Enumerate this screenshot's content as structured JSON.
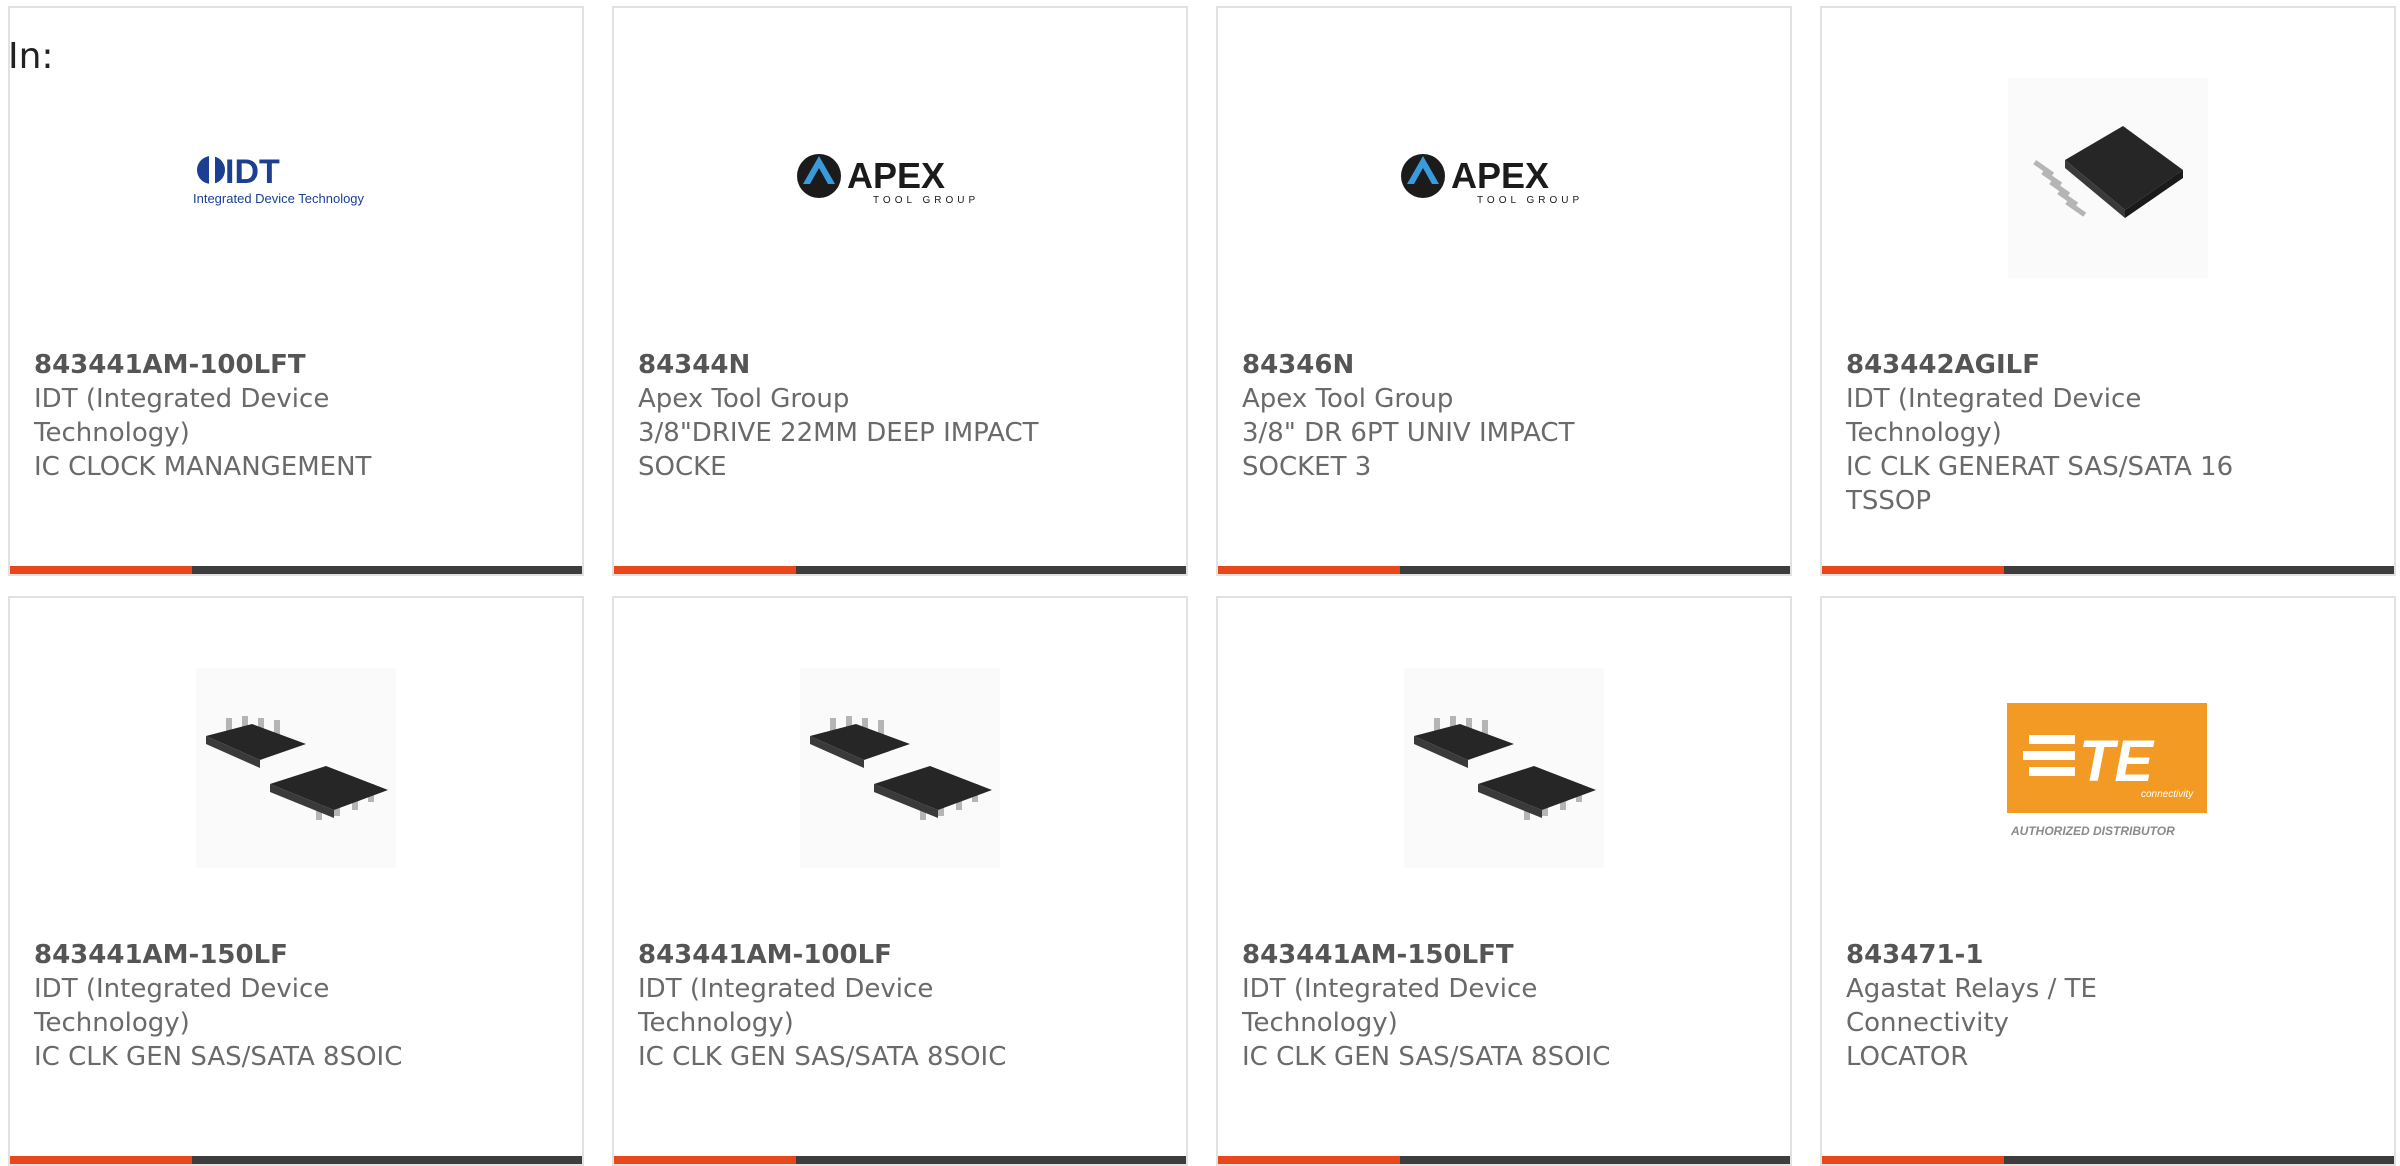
{
  "prefix_label": "In:",
  "colors": {
    "accent": "#e8461b",
    "bar": "#3d3d3d",
    "te_orange": "#f39a24",
    "idt_blue": "#1c3f94",
    "border": "#e1e1e1"
  },
  "cards": [
    {
      "part": "843441AM-100LFT",
      "manufacturer": "IDT (Integrated Device Technology)",
      "description": "IC CLOCK MANANGEMENT",
      "image": "idt-logo",
      "image_text": "IDT",
      "image_subtext": "Integrated Device Technology"
    },
    {
      "part": "84344N",
      "manufacturer": "Apex Tool Group",
      "description": "3/8\"DRIVE 22MM DEEP IMPACT SOCKE",
      "image": "apex-logo",
      "image_text": "APEX",
      "image_subtext": "TOOL GROUP"
    },
    {
      "part": "84346N",
      "manufacturer": "Apex Tool Group",
      "description": "3/8\" DR 6PT UNIV IMPACT SOCKET 3",
      "image": "apex-logo",
      "image_text": "APEX",
      "image_subtext": "TOOL GROUP"
    },
    {
      "part": "843442AGILF",
      "manufacturer": "IDT (Integrated Device Technology)",
      "description": "IC CLK GENERAT SAS/SATA 16 TSSOP",
      "image": "tssop-chip-photo"
    },
    {
      "part": "843441AM-150LF",
      "manufacturer": "IDT (Integrated Device Technology)",
      "description": "IC CLK GEN SAS/SATA 8SOIC",
      "image": "soic-chip-photo"
    },
    {
      "part": "843441AM-100LF",
      "manufacturer": "IDT (Integrated Device Technology)",
      "description": "IC CLK GEN SAS/SATA 8SOIC",
      "image": "soic-chip-photo"
    },
    {
      "part": "843441AM-150LFT",
      "manufacturer": "IDT (Integrated Device Technology)",
      "description": "IC CLK GEN SAS/SATA 8SOIC",
      "image": "soic-chip-photo"
    },
    {
      "part": "843471-1",
      "manufacturer": "Agastat Relays / TE Connectivity",
      "description": "LOCATOR",
      "image": "te-logo",
      "image_text": "TE",
      "image_subtext": "connectivity",
      "image_caption": "AUTHORIZED DISTRIBUTOR"
    }
  ]
}
